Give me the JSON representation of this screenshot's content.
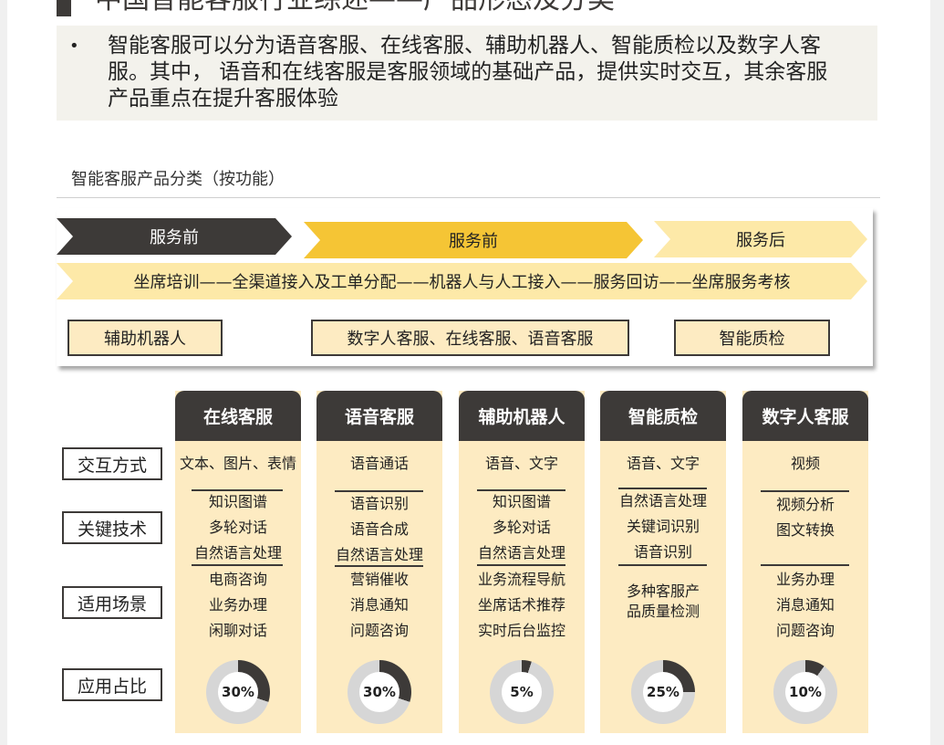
{
  "header": {
    "title": "中国智能客服行业综述——产品形态及分类",
    "bullet": "•",
    "summary": "智能客服可以分为语音客服、在线客服、辅助机器人、智能质检以及数字人客服。其中， 语音和在线客服是客服领域的基础产品，提供实时交互，其余客服产品重点在提升客服体验"
  },
  "section": {
    "title": "智能客服产品分类（按功能）"
  },
  "flow": {
    "stages": [
      "服务前",
      "服务前",
      "服务后"
    ],
    "process": "坐席培训——全渠道接入及工单分配——机器人与人工接入——服务回访——坐席服务考核",
    "boxes": [
      "辅助机器人",
      "数字人客服、在线客服、语音客服",
      "智能质检"
    ]
  },
  "row_labels": [
    "交互方式",
    "关键技术",
    "适用场景",
    "应用占比"
  ],
  "products": [
    {
      "name": "在线客服",
      "interaction": "文本、图片、表情",
      "tech": [
        "知识图谱",
        "多轮对话",
        "自然语言处理"
      ],
      "scenarios": [
        "电商咨询",
        "业务办理",
        "闲聊对话"
      ],
      "share": 30,
      "share_label": "30%"
    },
    {
      "name": "语音客服",
      "interaction": "语音通话",
      "tech": [
        "语音识别",
        "语音合成",
        "自然语言处理"
      ],
      "scenarios": [
        "营销催收",
        "消息通知",
        "问题咨询"
      ],
      "share": 30,
      "share_label": "30%"
    },
    {
      "name": "辅助机器人",
      "interaction": "语音、文字",
      "tech": [
        "知识图谱",
        "多轮对话",
        "自然语言处理"
      ],
      "scenarios": [
        "业务流程导航",
        "坐席话术推荐",
        "实时后台监控"
      ],
      "share": 5,
      "share_label": "5%"
    },
    {
      "name": "智能质检",
      "interaction": "语音、文字",
      "tech": [
        "自然语言处理",
        "关键词识别",
        "语音识别"
      ],
      "scenarios": [
        "多种客服产",
        "品质量检测"
      ],
      "share": 25,
      "share_label": "25%"
    },
    {
      "name": "数字人客服",
      "interaction": "视频",
      "tech": [
        "视频分析",
        "图文转换"
      ],
      "scenarios": [
        "业务办理",
        "消息通知",
        "问题咨询"
      ],
      "share": 10,
      "share_label": "10%"
    }
  ],
  "colors": {
    "dark": "#3d3a38",
    "gold": "#f5c535",
    "light_gold": "#fde9a8",
    "cream": "#fdebc2",
    "donut_gray": "#d6d6d6"
  }
}
